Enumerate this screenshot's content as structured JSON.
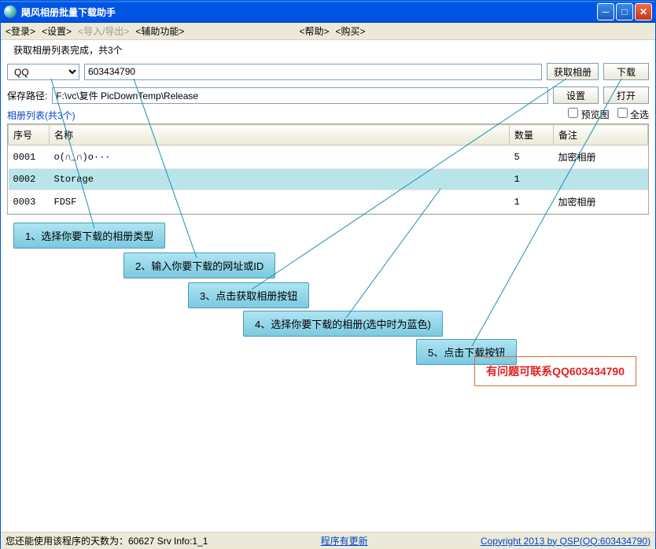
{
  "titlebar": {
    "title": "飓风相册批量下载助手"
  },
  "menubar": {
    "login": "<登录>",
    "settings": "<设置>",
    "import_export": "<导入/导出>",
    "aux": "<辅助功能>",
    "help": "<帮助>",
    "buy": "<购买>"
  },
  "status_line": "获取相册列表完成，共3个",
  "source": {
    "dropdown_value": "QQ",
    "id_value": "603434790"
  },
  "buttons": {
    "get_album": "获取相册",
    "download": "下载",
    "settings": "设置",
    "open": "打开"
  },
  "save_path": {
    "label": "保存路径:",
    "value": "F:\\vc\\复件 PicDownTemp\\Release"
  },
  "album_list_label": "相册列表(共3个)",
  "checks": {
    "preview": "预览图",
    "select_all": "全选"
  },
  "table": {
    "headers": {
      "num": "序号",
      "name": "名称",
      "count": "数量",
      "remark": "备注"
    },
    "rows": [
      {
        "num": "0001",
        "name": "o(∩_∩)o···",
        "count": "5",
        "remark": "加密相册",
        "selected": false
      },
      {
        "num": "0002",
        "name": "Storage",
        "count": "1",
        "remark": "",
        "selected": true
      },
      {
        "num": "0003",
        "name": "FDSF",
        "count": "1",
        "remark": "加密相册",
        "selected": false
      }
    ]
  },
  "callouts": {
    "c1": "1、选择你要下载的相册类型",
    "c2": "2、输入你要下载的网址或ID",
    "c3": "3、点击获取相册按钮",
    "c4": "4、选择你要下载的相册(选中时为蓝色)",
    "c5": "5、点击下载按钮"
  },
  "contact": "有问题可联系QQ603434790",
  "statusbar": {
    "left": "您还能使用该程序的天数为：60627  Srv Info:1_1",
    "center": "程序有更新",
    "right": "Copyright 2013 by QSP(QQ:603434790)"
  }
}
